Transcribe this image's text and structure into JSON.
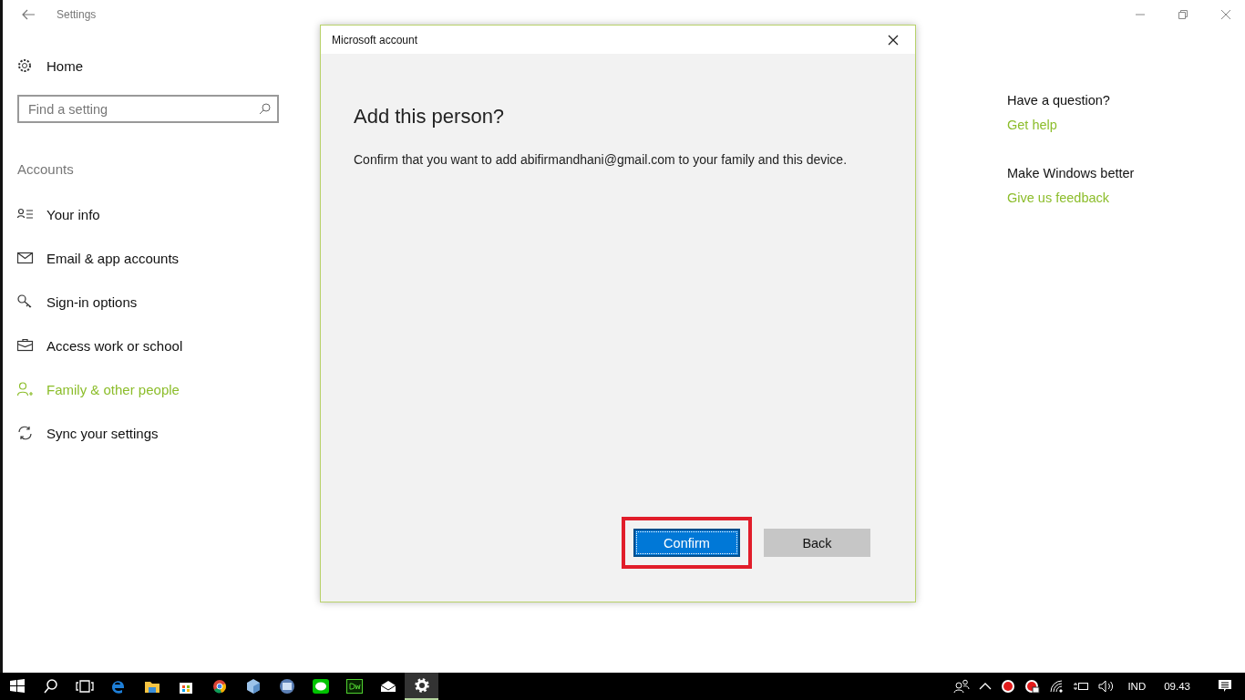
{
  "window": {
    "title": "Settings"
  },
  "sidebar": {
    "home": "Home",
    "search": {
      "placeholder": "Find a setting"
    },
    "section": "Accounts",
    "items": [
      {
        "label": "Your info",
        "selected": false
      },
      {
        "label": "Email & app accounts",
        "selected": false
      },
      {
        "label": "Sign-in options",
        "selected": false
      },
      {
        "label": "Access work or school",
        "selected": false
      },
      {
        "label": "Family & other people",
        "selected": true
      },
      {
        "label": "Sync your settings",
        "selected": false
      }
    ]
  },
  "help": [
    {
      "heading": "Have a question?",
      "link": "Get help"
    },
    {
      "heading": "Make Windows better",
      "link": "Give us feedback"
    }
  ],
  "dialog": {
    "title": "Microsoft account",
    "heading": "Add this person?",
    "message": "Confirm that you want to add abifirmandhani@gmail.com to your family and this device.",
    "buttons": [
      {
        "label": "Confirm",
        "kind": "primary",
        "focused": true,
        "highlighted": true
      },
      {
        "label": "Back",
        "kind": "secondary",
        "focused": false,
        "highlighted": false
      }
    ]
  },
  "taskbar": {
    "apps": [
      {
        "kind": "start",
        "active": false
      },
      {
        "kind": "search",
        "active": false
      },
      {
        "kind": "task-view",
        "active": false
      },
      {
        "kind": "browser",
        "active": false
      },
      {
        "kind": "folder",
        "active": false
      },
      {
        "kind": "store",
        "active": false
      },
      {
        "kind": "chrome",
        "active": false
      },
      {
        "kind": "cube",
        "active": false
      },
      {
        "kind": "window",
        "active": false
      },
      {
        "kind": "chat",
        "active": false
      },
      {
        "kind": "dw",
        "active": false
      },
      {
        "kind": "mail",
        "active": false
      },
      {
        "kind": "gear",
        "active": true
      }
    ],
    "language": "IND",
    "time": "09.43"
  }
}
